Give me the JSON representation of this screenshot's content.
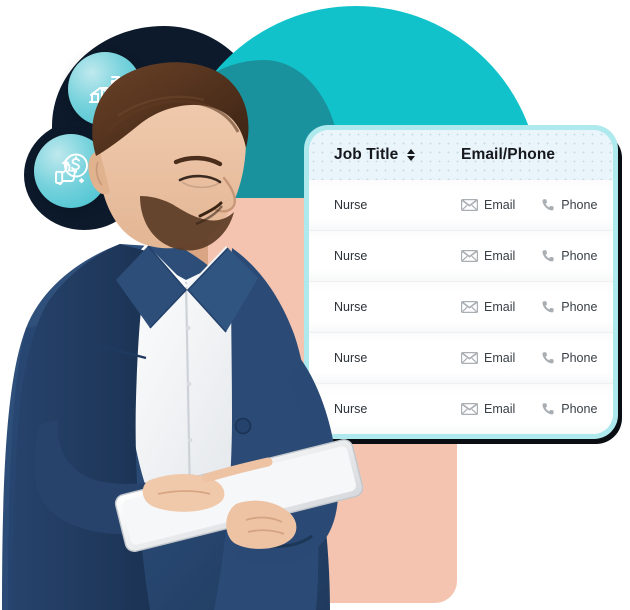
{
  "page": {
    "title": "Contact list widget",
    "colors": {
      "teal_circle": "#12c2cb",
      "teal_dark": "#1a8f9b",
      "peach": "#f5c4b0",
      "dark_blob": "#0c1a2b",
      "card_border": "#aee9ee",
      "header_bg": "#e9f5fb",
      "suit_navy": "#2a4a75"
    }
  },
  "badges": [
    {
      "name": "growth-chart-badge",
      "icon": "bar-chart-growth-icon",
      "label": ""
    },
    {
      "name": "money-thumbs-up-badge",
      "icon": "thumbs-up-dollar-icon",
      "label": ""
    }
  ],
  "table": {
    "columns": [
      {
        "key": "job_title",
        "label": "Job Title",
        "sortable": true,
        "sort_icon": "sort-arrows-icon"
      },
      {
        "key": "contact",
        "label": "Email/Phone",
        "sortable": false
      }
    ],
    "contact_actions": {
      "email": {
        "label": "Email",
        "icon": "envelope-icon"
      },
      "phone": {
        "label": "Phone",
        "icon": "phone-handset-icon"
      }
    },
    "rows": [
      {
        "job_title": "Nurse",
        "email": "Email",
        "phone": "Phone"
      },
      {
        "job_title": "Nurse",
        "email": "Email",
        "phone": "Phone"
      },
      {
        "job_title": "Nurse",
        "email": "Email",
        "phone": "Phone"
      },
      {
        "job_title": "Nurse",
        "email": "Email",
        "phone": "Phone"
      },
      {
        "job_title": "Nurse",
        "email": "Email",
        "phone": "Phone"
      }
    ]
  }
}
